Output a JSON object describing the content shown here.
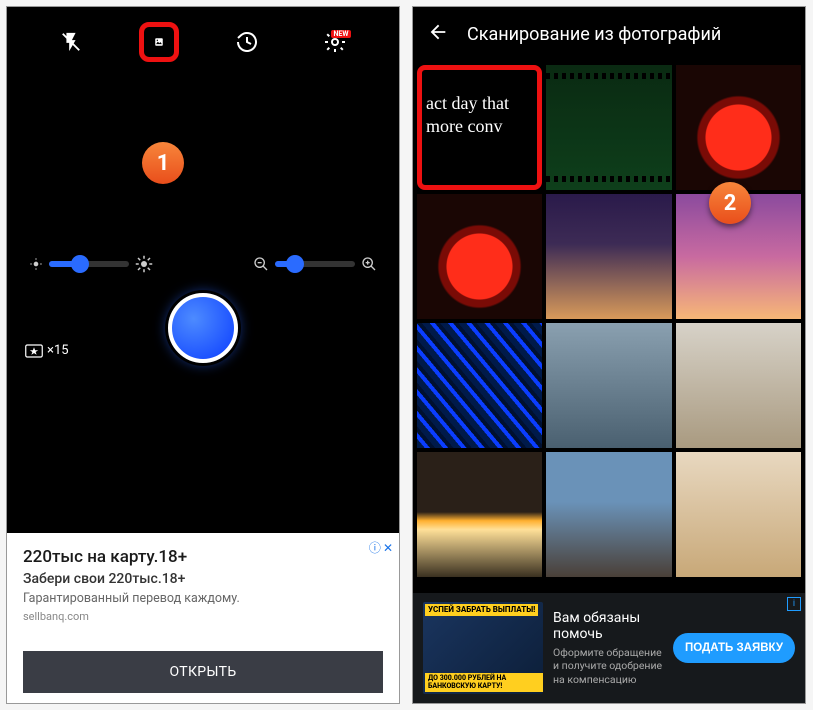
{
  "left": {
    "topbar": {
      "flash_icon": "flash-off",
      "gallery_icon": "image",
      "history_icon": "history",
      "settings_icon": "settings",
      "settings_badge": "NEW"
    },
    "step1_number": "1",
    "credits_count": "×15",
    "ad": {
      "headline": "220тыс на карту.18+",
      "sub": "Забери свои 220тыс.18+",
      "desc": "Гарантированный перевод каждому.",
      "domain": "sellbanq.com",
      "cta": "ОТКРЫТЬ",
      "info_glyph": "ⓘ",
      "close_glyph": "✕"
    }
  },
  "right": {
    "title": "Сканирование из фотографий",
    "step2_number": "2",
    "thumb0_line1": "act day that",
    "thumb0_line2": "more conv",
    "ad": {
      "img_top": "УСПЕЙ ЗАБРАТЬ\nВЫПЛАТЫ!",
      "img_bottom": "ДО 300.000 РУБЛЕЙ\nНА БАНКОВСКУЮ КАРТУ!",
      "headline": "Вам обязаны помочь",
      "desc": "Оформите обращение и получите одобрение на компенсацию",
      "cta": "ПОДАТЬ ЗАЯВКУ",
      "info_glyph": "i"
    }
  }
}
